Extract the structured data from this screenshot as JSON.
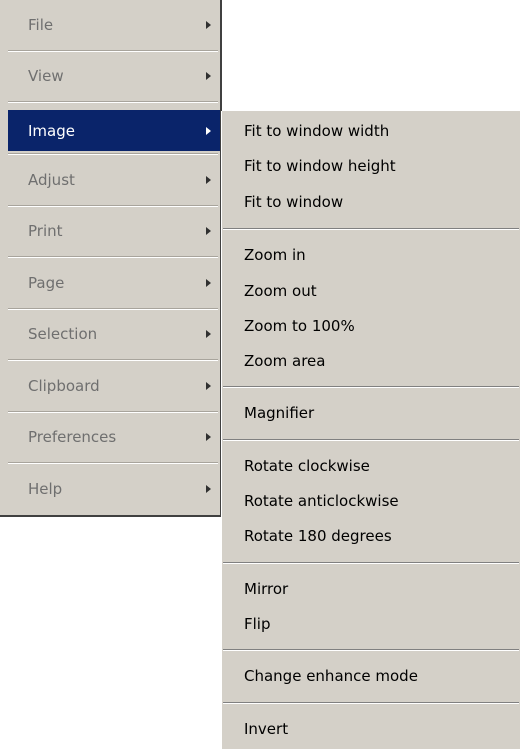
{
  "main_menu": {
    "items": [
      {
        "label": "File"
      },
      {
        "label": "View"
      },
      {
        "label": "Image"
      },
      {
        "label": "Adjust"
      },
      {
        "label": "Print"
      },
      {
        "label": "Page"
      },
      {
        "label": "Selection"
      },
      {
        "label": "Clipboard"
      },
      {
        "label": "Preferences"
      },
      {
        "label": "Help"
      }
    ],
    "active_item": "Image"
  },
  "submenu": {
    "items": [
      {
        "label": "Fit to window width"
      },
      {
        "label": "Fit to window height"
      },
      {
        "label": "Fit to window"
      },
      {
        "label": "Zoom in"
      },
      {
        "label": "Zoom out"
      },
      {
        "label": "Zoom to 100%"
      },
      {
        "label": "Zoom area"
      },
      {
        "label": "Magnifier"
      },
      {
        "label": "Rotate clockwise"
      },
      {
        "label": "Rotate anticlockwise"
      },
      {
        "label": "Rotate 180 degrees"
      },
      {
        "label": "Mirror"
      },
      {
        "label": "Flip"
      },
      {
        "label": "Change enhance mode"
      },
      {
        "label": "Invert"
      }
    ]
  },
  "colors": {
    "menu_bg": "#d4d0c8",
    "highlight_bg": "#0a246a",
    "highlight_text": "#ffffff",
    "disabled_text": "#6f6f6f"
  }
}
